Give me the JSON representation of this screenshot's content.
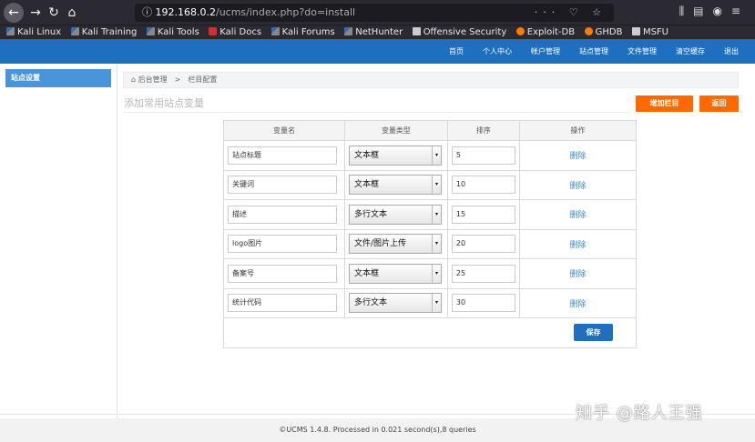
{
  "browser": {
    "url_host": "192.168.0.2",
    "url_path": "/ucms/index.php?do=install",
    "url_actions": "··· ♡ ☆",
    "bookmarks": [
      "Kali Linux",
      "Kali Training",
      "Kali Tools",
      "Kali Docs",
      "Kali Forums",
      "NetHunter",
      "Offensive Security",
      "Exploit-DB",
      "GHDB",
      "MSFU"
    ]
  },
  "topnav": [
    "首页",
    "个人中心",
    "帐户管理",
    "站点管理",
    "文件管理",
    "清空缓存",
    "退出"
  ],
  "sidebar": {
    "item": "站点设置"
  },
  "breadcrumb": {
    "home": "后台管理",
    "sep": ">",
    "current": "栏目配置"
  },
  "page": {
    "heading": "添加常用站点变量",
    "add_button": "增加栏目",
    "back_button": "返回"
  },
  "table": {
    "headers": [
      "变量名",
      "变量类型",
      "排序",
      "操作"
    ],
    "rows": [
      {
        "name": "站点标题",
        "type": "文本框",
        "sort": "5",
        "action": "删除"
      },
      {
        "name": "关键词",
        "type": "文本框",
        "sort": "10",
        "action": "删除"
      },
      {
        "name": "描述",
        "type": "多行文本",
        "sort": "15",
        "action": "删除"
      },
      {
        "name": "logo图片",
        "type": "文件/图片上传",
        "sort": "20",
        "action": "删除"
      },
      {
        "name": "备案号",
        "type": "文本框",
        "sort": "25",
        "action": "删除"
      },
      {
        "name": "统计代码",
        "type": "多行文本",
        "sort": "30",
        "action": "删除"
      }
    ],
    "save_button": "保存"
  },
  "footer": "©UCMS 1.4.8. Processed in 0.021 second(s),8 queries",
  "watermark": "知乎 @路人王强"
}
